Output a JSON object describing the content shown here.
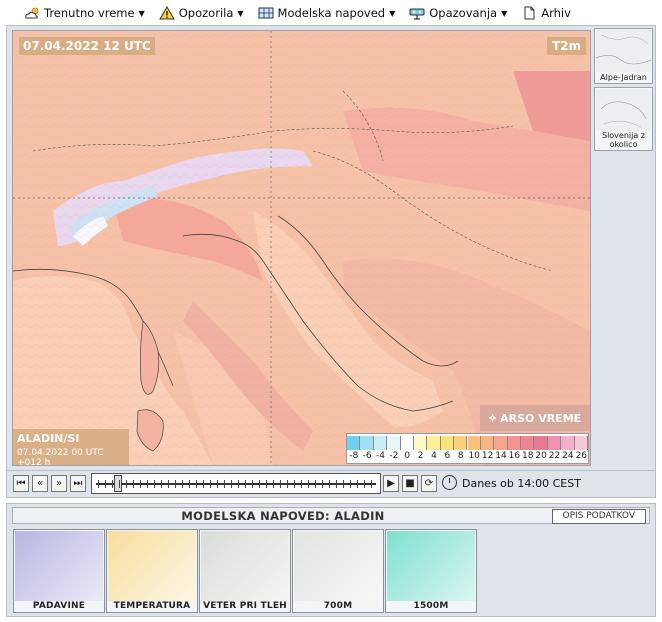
{
  "menu": [
    {
      "label": "Trenutno vreme",
      "icon": "cloud-sun-icon",
      "has_dropdown": true
    },
    {
      "label": "Opozorila",
      "icon": "warning-icon",
      "has_dropdown": true
    },
    {
      "label": "Modelska napoved",
      "icon": "model-grid-icon",
      "has_dropdown": true
    },
    {
      "label": "Opazovanja",
      "icon": "radar-station-icon",
      "has_dropdown": true
    },
    {
      "label": "Arhiv",
      "icon": "document-icon",
      "has_dropdown": false
    }
  ],
  "map": {
    "date_label": "07.04.2022 12 UTC",
    "variable_label": "T2m",
    "model_label": "ALADIN/SI",
    "run_label": "07.04.2022 00 UTC +012 h",
    "brand_label": "ARSO VREME"
  },
  "legend": {
    "labels": [
      "-8",
      "-6",
      "-4",
      "-2",
      "0",
      "2",
      "4",
      "6",
      "8",
      "10",
      "12",
      "14",
      "16",
      "18",
      "20",
      "22",
      "24",
      "26"
    ],
    "colors": [
      "#6fd0ef",
      "#9fe0f3",
      "#c8eef6",
      "#e9f6f6",
      "#fbfbfb",
      "#fff8c8",
      "#ffee9a",
      "#ffe17c",
      "#fdd07a",
      "#fbc27c",
      "#f9b483",
      "#f7a58a",
      "#f49392",
      "#ef8494",
      "#ea7896",
      "#ed92b0",
      "#f2b0cc",
      "#f7c8da"
    ]
  },
  "side_thumbs": [
    {
      "label": "Alpe-Jadran"
    },
    {
      "label": "Slovenija z okolico"
    }
  ],
  "controls": {
    "time_label": "Danes ob 14:00 CEST",
    "buttons": [
      "first",
      "back",
      "forward",
      "last",
      "play",
      "stop",
      "loop"
    ]
  },
  "panel": {
    "title": "MODELSKA NAPOVED: ALADIN",
    "info_button": "OPIS PODATKOV",
    "thumbs": [
      {
        "label": "PADAVINE",
        "color": "#b9b6e2"
      },
      {
        "label": "TEMPERATURA",
        "color": "#f6df9e"
      },
      {
        "label": "VETER PRI TLEH",
        "color": "#d9ddd9"
      },
      {
        "label": "700M",
        "color": "#e2e4e2"
      },
      {
        "label": "1500M",
        "color": "#7fe0cf"
      }
    ]
  }
}
